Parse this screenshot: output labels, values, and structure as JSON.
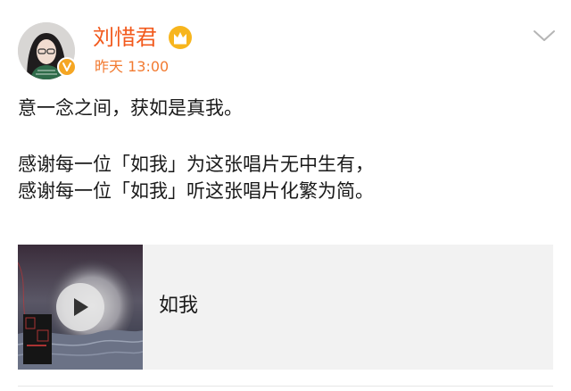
{
  "user": {
    "name": "刘惜君",
    "badge_icon": "crown-icon",
    "verified_icon": "verified-v-icon",
    "name_color": "#f25a1d"
  },
  "post": {
    "timestamp": "昨天 13:00",
    "lines": [
      "意一念之间，获如是真我。",
      "感谢每一位「如我」为这张唱片无中生有，",
      "感谢每一位「如我」听这张唱片化繁为简。"
    ]
  },
  "music_card": {
    "title": "如我",
    "play_icon": "play-icon"
  },
  "menu_icon": "chevron-down-icon"
}
